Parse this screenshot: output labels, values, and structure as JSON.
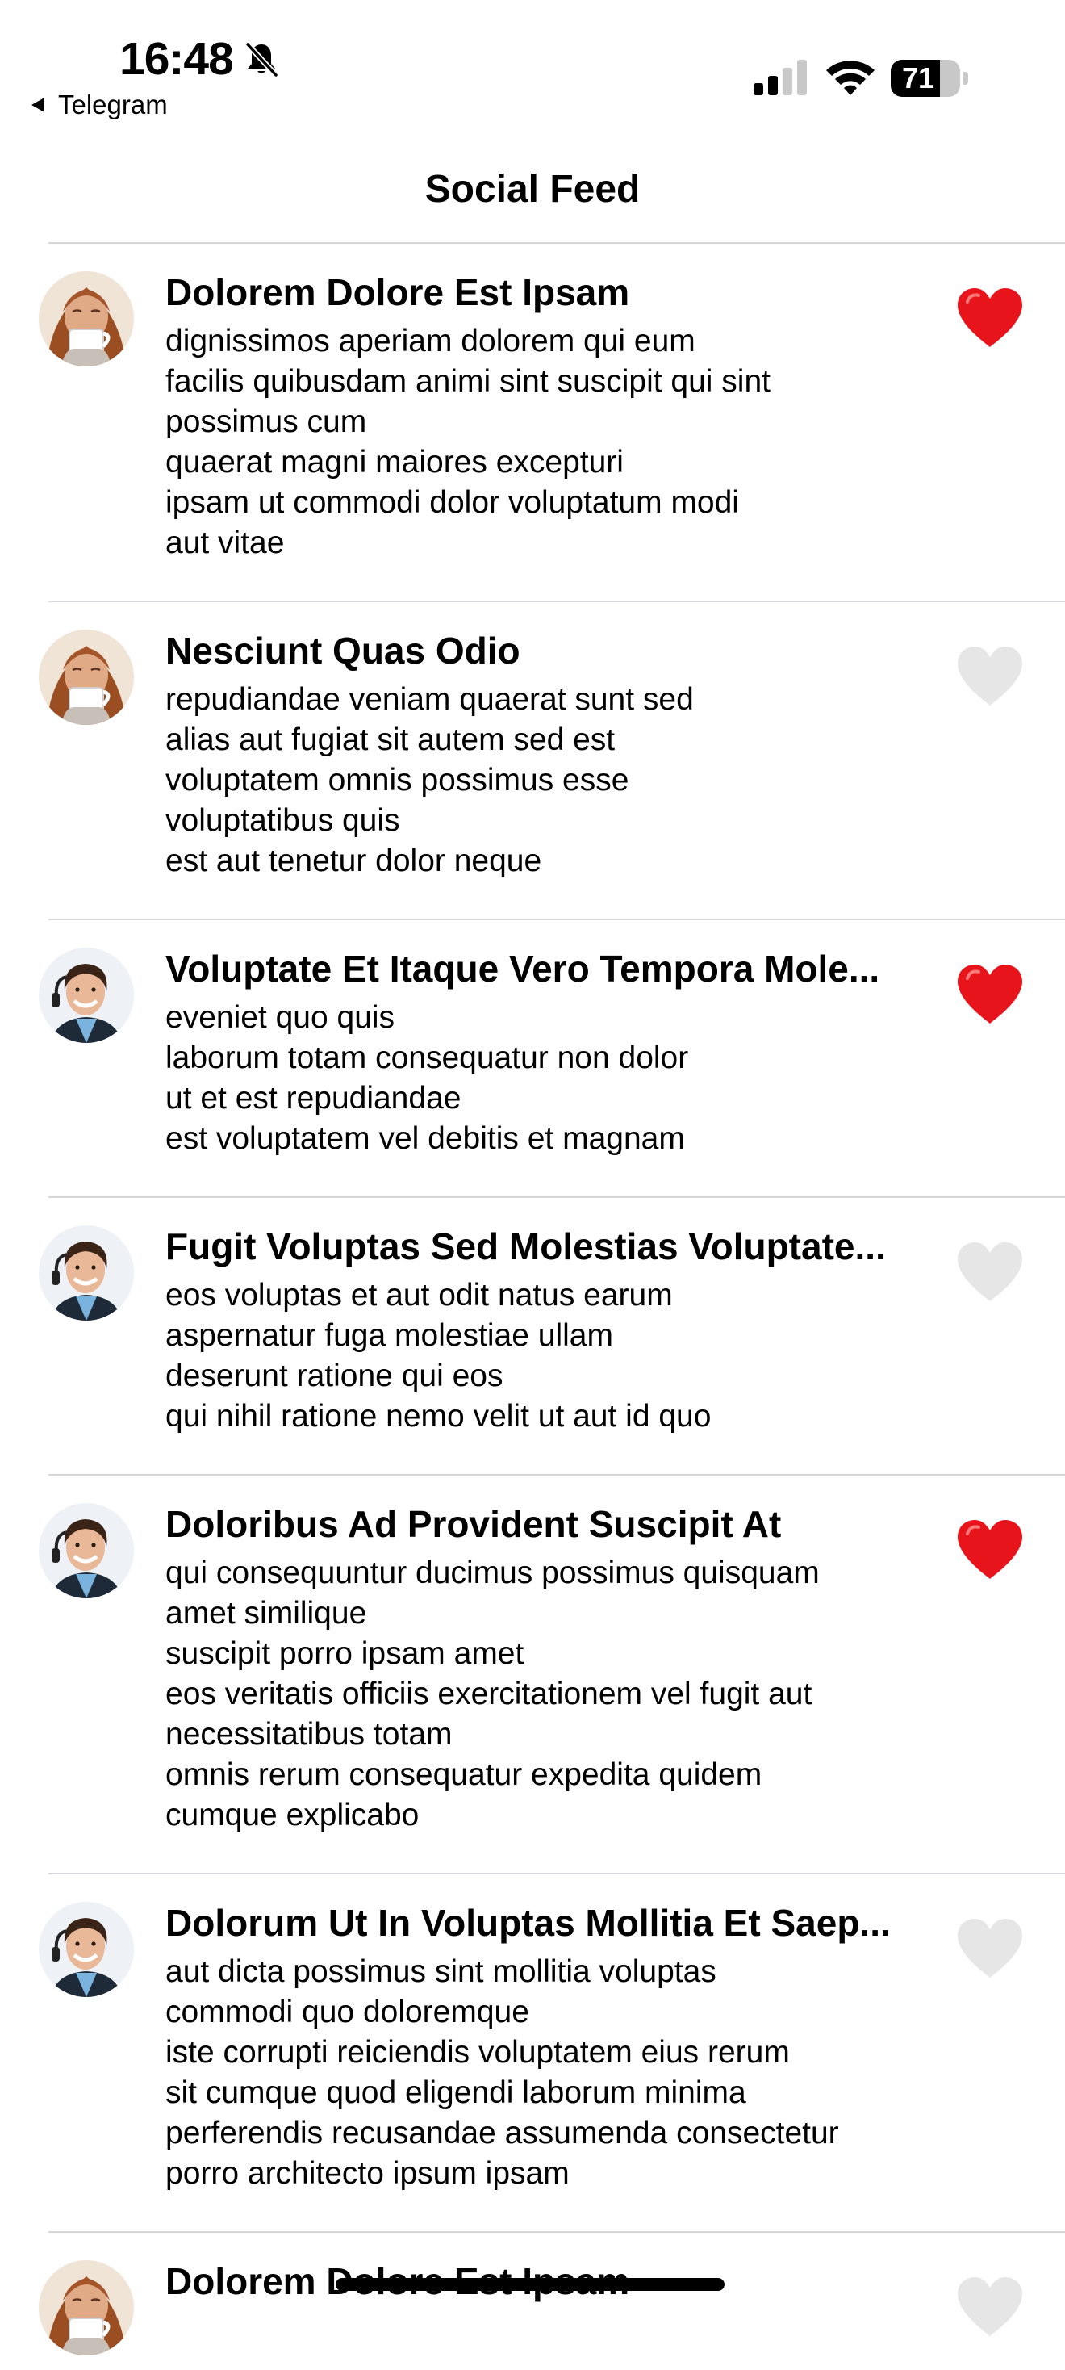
{
  "status_bar": {
    "time": "16:48",
    "back_label": "Telegram",
    "battery_percent": 71
  },
  "nav": {
    "title": "Social Feed"
  },
  "colors": {
    "liked_heart": "#e8141b",
    "unliked_heart": "#e6e6e6",
    "divider": "#d6d6da"
  },
  "posts": [
    {
      "avatar": "woman-drinking-coffee-avatar",
      "title": "Dolorem Dolore Est Ipsam",
      "body": [
        "dignissimos aperiam dolorem qui eum",
        "facilis quibusdam animi sint suscipit qui sint",
        "possimus cum",
        "quaerat magni maiores excepturi",
        "ipsam ut commodi dolor voluptatum modi",
        "aut vitae"
      ],
      "liked": true
    },
    {
      "avatar": "woman-drinking-coffee-avatar",
      "title": "Nesciunt Quas Odio",
      "body": [
        "repudiandae veniam quaerat sunt sed",
        "alias aut fugiat sit autem sed est",
        "voluptatem omnis possimus esse",
        "voluptatibus quis",
        "est aut tenetur dolor neque"
      ],
      "liked": false
    },
    {
      "avatar": "smiling-man-avatar",
      "title": "Voluptate Et Itaque Vero Tempora Mole...",
      "body": [
        "eveniet quo quis",
        "laborum totam consequatur non dolor",
        "ut et est repudiandae",
        "est voluptatem vel debitis et magnam"
      ],
      "liked": true
    },
    {
      "avatar": "smiling-man-avatar",
      "title": "Fugit Voluptas Sed Molestias Voluptate...",
      "body": [
        "eos voluptas et aut odit natus earum",
        "aspernatur fuga molestiae ullam",
        "deserunt ratione qui eos",
        "qui nihil ratione nemo velit ut aut id quo"
      ],
      "liked": false
    },
    {
      "avatar": "smiling-man-avatar",
      "title": "Doloribus Ad Provident Suscipit At",
      "body": [
        "qui consequuntur ducimus possimus quisquam",
        "amet similique",
        "suscipit porro ipsam amet",
        "eos veritatis officiis exercitationem vel fugit aut",
        "necessitatibus totam",
        "omnis rerum consequatur expedita quidem",
        "cumque explicabo"
      ],
      "liked": true
    },
    {
      "avatar": "smiling-man-avatar",
      "title": "Dolorum Ut In Voluptas Mollitia Et Saep...",
      "body": [
        "aut dicta possimus sint mollitia voluptas",
        "commodi quo doloremque",
        "iste corrupti reiciendis voluptatem eius rerum",
        "sit cumque quod eligendi laborum minima",
        "perferendis recusandae assumenda consectetur",
        "porro architecto ipsum ipsam"
      ],
      "liked": false
    },
    {
      "avatar": "woman-drinking-coffee-avatar",
      "title": "Dolorem Dolore Est Ipsam",
      "body": [],
      "liked": false
    }
  ]
}
